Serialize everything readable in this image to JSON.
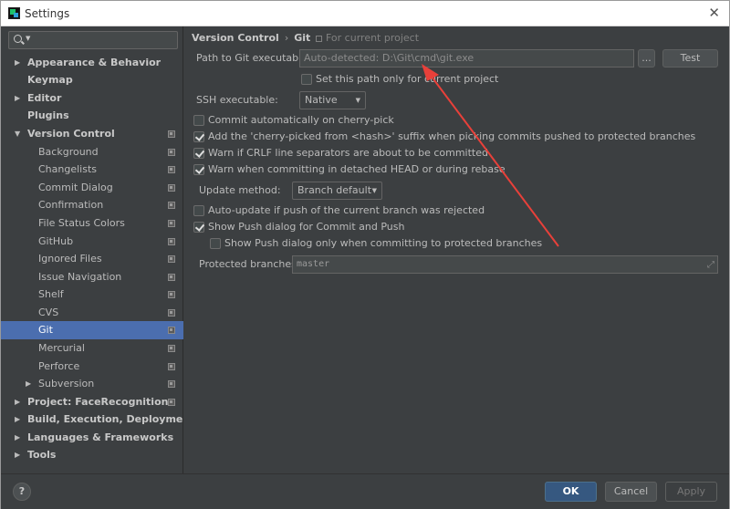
{
  "window": {
    "title": "Settings"
  },
  "sidebar": {
    "search_placeholder": "",
    "items": [
      {
        "label": "Appearance & Behavior"
      },
      {
        "label": "Keymap"
      },
      {
        "label": "Editor"
      },
      {
        "label": "Plugins"
      },
      {
        "label": "Version Control"
      },
      {
        "label": "Background"
      },
      {
        "label": "Changelists"
      },
      {
        "label": "Commit Dialog"
      },
      {
        "label": "Confirmation"
      },
      {
        "label": "File Status Colors"
      },
      {
        "label": "GitHub"
      },
      {
        "label": "Ignored Files"
      },
      {
        "label": "Issue Navigation"
      },
      {
        "label": "Shelf"
      },
      {
        "label": "CVS"
      },
      {
        "label": "Git"
      },
      {
        "label": "Mercurial"
      },
      {
        "label": "Perforce"
      },
      {
        "label": "Subversion"
      },
      {
        "label": "Project: FaceRecognition"
      },
      {
        "label": "Build, Execution, Deployment"
      },
      {
        "label": "Languages & Frameworks"
      },
      {
        "label": "Tools"
      }
    ],
    "selected": "Git"
  },
  "main": {
    "breadcrumb": {
      "parent": "Version Control",
      "separator": "›",
      "current": "Git"
    },
    "for_current_project": "For current project",
    "path_label": "Path to Git executable:",
    "path_value": "Auto-detected: D:\\Git\\cmd\\git.exe",
    "browse_label": "...",
    "test_label": "Test",
    "set_path_only": {
      "label": "Set this path only for current project",
      "checked": false
    },
    "ssh_label": "SSH executable:",
    "ssh_value": "Native",
    "commit_cherry": {
      "label": "Commit automatically on cherry-pick",
      "checked": false
    },
    "add_cherry": {
      "label": "Add the 'cherry-picked from <hash>' suffix when picking commits pushed to protected branches",
      "checked": true
    },
    "warn_crlf": {
      "label": "Warn if CRLF line separators are about to be committed",
      "checked": true
    },
    "warn_detached": {
      "label": "Warn when committing in detached HEAD or during rebase",
      "checked": true
    },
    "update_method_label": "Update method:",
    "update_method_value": "Branch default",
    "auto_update": {
      "label": "Auto-update if push of the current branch was rejected",
      "checked": false
    },
    "show_push": {
      "label": "Show Push dialog for Commit and Push",
      "checked": true
    },
    "show_push_protected": {
      "label": "Show Push dialog only when committing to protected branches",
      "checked": false
    },
    "protected_label": "Protected branches:",
    "protected_value": "master"
  },
  "footer": {
    "help": "?",
    "ok": "OK",
    "cancel": "Cancel",
    "apply": "Apply"
  },
  "colors": {
    "accent": "#4b6eaf",
    "ok_button": "#365880",
    "annotation_arrow": "#e8403a"
  }
}
